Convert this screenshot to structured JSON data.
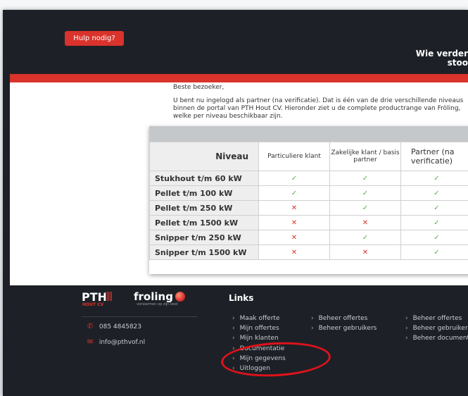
{
  "header": {
    "help_button": "Hulp nodig?",
    "tagline_line1": "Wie verder",
    "tagline_line2": "stoo"
  },
  "intro": {
    "greeting": "Beste bezoeker,",
    "paragraph": "U bent nu ingelogd als partner (na verificatie). Dat is één van de drie verschillende niveaus binnen de portal van PTH Hout CV. Hieronder ziet u de complete productrange van Fröling, welke per niveau beschikbaar zijn."
  },
  "table": {
    "col_niveau": "Niveau",
    "col1": "Particuliere klant",
    "col2": "Zakelijke klant / basis partner",
    "col3": "Partner (na verificatie)",
    "rows": [
      {
        "label": "Stukhout t/m 60 kW",
        "c1": "✓",
        "c2": "✓",
        "c3": "✓",
        "c1_ok": true,
        "c2_ok": true,
        "c3_ok": true
      },
      {
        "label": "Pellet t/m 100 kW",
        "c1": "✓",
        "c2": "✓",
        "c3": "✓",
        "c1_ok": true,
        "c2_ok": true,
        "c3_ok": true
      },
      {
        "label": "Pellet t/m 250 kW",
        "c1": "✕",
        "c2": "✓",
        "c3": "✓",
        "c1_ok": false,
        "c2_ok": true,
        "c3_ok": true
      },
      {
        "label": "Pellet t/m 1500 kW",
        "c1": "✕",
        "c2": "✕",
        "c3": "✓",
        "c1_ok": false,
        "c2_ok": false,
        "c3_ok": true
      },
      {
        "label": "Snipper t/m 250 kW",
        "c1": "✕",
        "c2": "✓",
        "c3": "✓",
        "c1_ok": false,
        "c2_ok": true,
        "c3_ok": true
      },
      {
        "label": "Snipper t/m 1500 kW",
        "c1": "✕",
        "c2": "✕",
        "c3": "✓",
        "c1_ok": false,
        "c2_ok": false,
        "c3_ok": true
      }
    ]
  },
  "footer": {
    "logo_pth": "PTH",
    "logo_pth_sub": "HOUT CV",
    "logo_froling": "froling",
    "logo_froling_sub": "verwarmen op zijn best",
    "phone": "085 4845823",
    "email": "info@pthvof.nl",
    "links_title": "Links",
    "links_col1": [
      "Maak offerte",
      "Mijn offertes",
      "Mijn klanten",
      "Documentatie",
      "Mijn gegevens",
      "Uitloggen"
    ],
    "links_col2": [
      "Beheer offertes",
      "Beheer gebruikers"
    ],
    "links_col3": [
      "Beheer offertes",
      "Beheer gebruikers",
      "Beheer documenten"
    ]
  },
  "colors": {
    "accent_red": "#d9332c",
    "check_green": "#5cae4d",
    "footer_bg": "#1d2127",
    "annotation_red": "#e0121b"
  },
  "icons": {
    "phone": "phone-icon",
    "email": "envelope-icon",
    "link_chevron": "chevron-right-icon"
  }
}
